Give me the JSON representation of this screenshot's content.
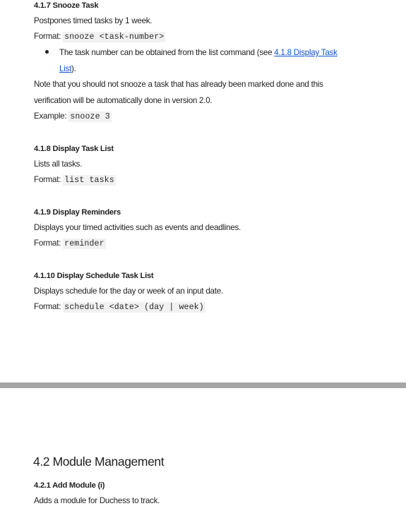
{
  "sections": {
    "snooze": {
      "heading": "4.1.7 Snooze Task",
      "description": "Postpones timed tasks by 1 week.",
      "format_label": "Format: ",
      "format_code": "snooze <task-number>",
      "bullet_text": "The task number can be obtained from the list command (see ",
      "bullet_link_part1": "4.1.8 Display Task",
      "bullet_link_part2": "List",
      "bullet_suffix": ").",
      "note_line1": "Note that you should not snooze a task that has already been marked done and this",
      "note_line2": "verification will be automatically done in version 2.0.",
      "example_label": "Example: ",
      "example_code": "snooze 3"
    },
    "display_list": {
      "heading": "4.1.8 Display Task List",
      "description": "Lists all tasks.",
      "format_label": "Format: ",
      "format_code": "list tasks"
    },
    "reminders": {
      "heading": "4.1.9 Display Reminders",
      "description": "Displays your timed activities such as events and deadlines.",
      "format_label": "Format: ",
      "format_code": "reminder"
    },
    "schedule": {
      "heading": "4.1.10 Display Schedule Task List",
      "description": "Displays schedule for the day or week of an input date.",
      "format_label": "Format: ",
      "format_code": "schedule <date> (day | week)"
    },
    "module_management": {
      "title": "4.2 Module Management",
      "heading": "4.2.1 Add Module (i)",
      "description": "Adds a module for Duchess to track."
    }
  }
}
